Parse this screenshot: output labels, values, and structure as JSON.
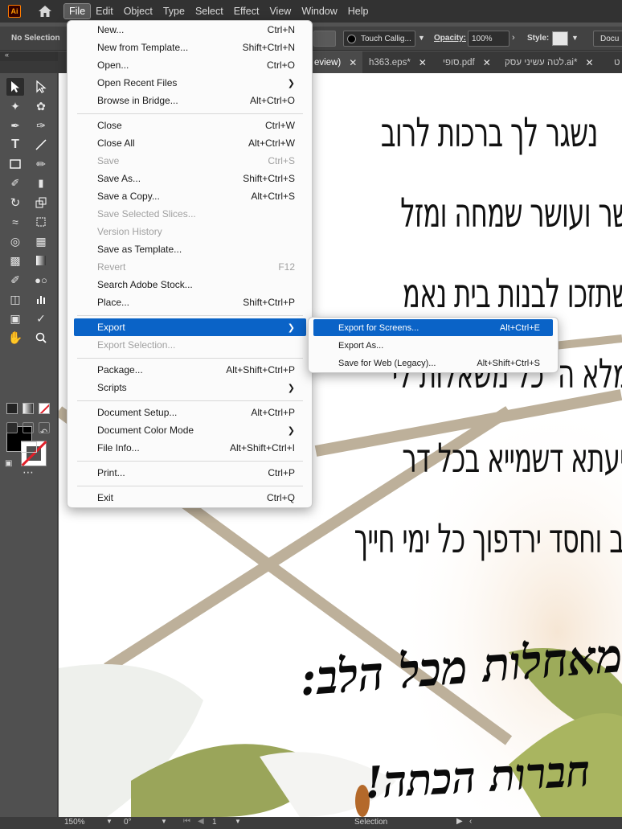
{
  "menubar": {
    "app_logo": "Ai",
    "items": [
      "File",
      "Edit",
      "Object",
      "Type",
      "Select",
      "Effect",
      "View",
      "Window",
      "Help"
    ],
    "active_item": "File"
  },
  "controlbar": {
    "selection": "No Selection",
    "brush": "Touch Callig...",
    "opacity_label": "Opacity:",
    "opacity_value": "100%",
    "style_label": "Style:",
    "document_btn": "Docu"
  },
  "tabs": [
    {
      "label": "eview)",
      "active": true
    },
    {
      "label": "h363.eps*",
      "active": false
    },
    {
      "label": "סופי.pdf",
      "active": false
    },
    {
      "label": "לטה עשיני עסק.ai*",
      "active": false
    },
    {
      "label": "ט",
      "active": false
    }
  ],
  "artboard": {
    "lines": [
      "נשגר לך ברכות לרוב",
      "שר ועושר שמחה ומזל",
      "שתזכו לבנות בית נאמ",
      "מלא ה' כל משאלות לי",
      "ייעתא דשמייא בכל דר",
      "וב וחסד ירדפוך כל ימי חייך"
    ],
    "callig_line1": "מאחלות מכל הלב:",
    "callig_line2": "חברות הכתה!"
  },
  "statusbar": {
    "zoom": "150%",
    "rotate": "0°",
    "artboard_num": "1",
    "tool": "Selection"
  },
  "filemenu": {
    "items": [
      {
        "label": "New...",
        "shortcut": "Ctrl+N"
      },
      {
        "label": "New from Template...",
        "shortcut": "Shift+Ctrl+N"
      },
      {
        "label": "Open...",
        "shortcut": "Ctrl+O"
      },
      {
        "label": "Open Recent Files",
        "shortcut": "",
        "submenu": true
      },
      {
        "label": "Browse in Bridge...",
        "shortcut": "Alt+Ctrl+O"
      },
      {
        "label": "Close",
        "shortcut": "Ctrl+W"
      },
      {
        "label": "Close All",
        "shortcut": "Alt+Ctrl+W"
      },
      {
        "label": "Save",
        "shortcut": "Ctrl+S",
        "disabled": true
      },
      {
        "label": "Save As...",
        "shortcut": "Shift+Ctrl+S"
      },
      {
        "label": "Save a Copy...",
        "shortcut": "Alt+Ctrl+S"
      },
      {
        "label": "Save Selected Slices...",
        "shortcut": "",
        "disabled": true
      },
      {
        "label": "Version History",
        "shortcut": "",
        "disabled": true
      },
      {
        "label": "Save as Template...",
        "shortcut": ""
      },
      {
        "label": "Revert",
        "shortcut": "F12",
        "disabled": true
      },
      {
        "label": "Search Adobe Stock...",
        "shortcut": ""
      },
      {
        "label": "Place...",
        "shortcut": "Shift+Ctrl+P"
      },
      {
        "label": "Export",
        "shortcut": "",
        "submenu": true,
        "highlighted": true
      },
      {
        "label": "Export Selection...",
        "shortcut": "",
        "disabled": true
      },
      {
        "label": "Package...",
        "shortcut": "Alt+Shift+Ctrl+P"
      },
      {
        "label": "Scripts",
        "shortcut": "",
        "submenu": true
      },
      {
        "label": "Document Setup...",
        "shortcut": "Alt+Ctrl+P"
      },
      {
        "label": "Document Color Mode",
        "shortcut": "",
        "submenu": true
      },
      {
        "label": "File Info...",
        "shortcut": "Alt+Shift+Ctrl+I"
      },
      {
        "label": "Print...",
        "shortcut": "Ctrl+P"
      },
      {
        "label": "Exit",
        "shortcut": "Ctrl+Q"
      }
    ]
  },
  "exportmenu": {
    "items": [
      {
        "label": "Export for Screens...",
        "shortcut": "Alt+Ctrl+E",
        "highlighted": true
      },
      {
        "label": "Export As...",
        "shortcut": ""
      },
      {
        "label": "Save for Web (Legacy)...",
        "shortcut": "Alt+Shift+Ctrl+S"
      }
    ]
  },
  "colors": {
    "menu_highlight": "#0a63c7",
    "ui_dark": "#323232",
    "panel": "#505050",
    "ai_orange": "#ff9a00",
    "beige_lines": "#bdb09a"
  }
}
